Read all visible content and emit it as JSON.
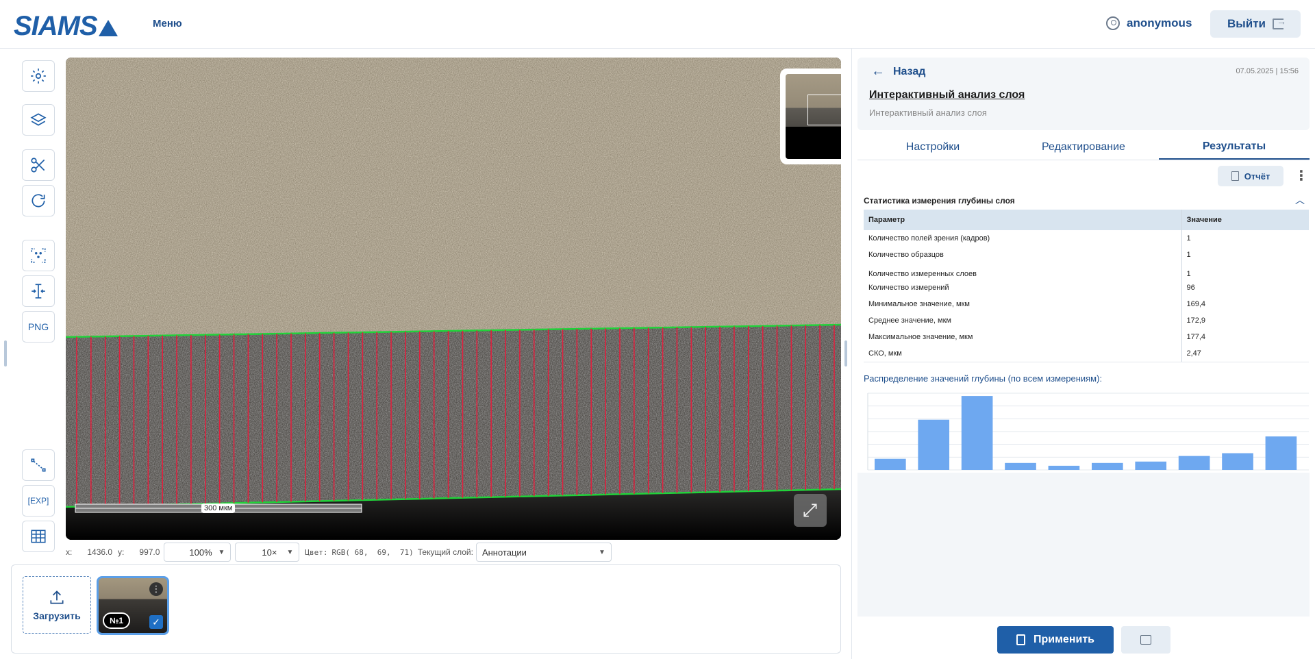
{
  "header": {
    "logo": "SIAMS",
    "menu_label": "Меню",
    "username": "anonymous",
    "logout_label": "Выйти"
  },
  "toolbar": {
    "tools": [
      {
        "name": "settings-icon"
      },
      {
        "name": "layers-icon"
      },
      {
        "name": "scissors-icon"
      },
      {
        "name": "refresh-icon"
      },
      {
        "name": "focus-points-icon"
      },
      {
        "name": "measure-icon"
      },
      {
        "name": "png-export",
        "label": "PNG"
      },
      {
        "name": "line-tool-icon"
      },
      {
        "name": "exp-export",
        "label": "EXP"
      },
      {
        "name": "table-icon"
      }
    ]
  },
  "viewer": {
    "scale_bar_label": "300 мкм",
    "measurement_count": 54
  },
  "status": {
    "x_label": "x:",
    "x_value": "1436.0",
    "y_label": "y:",
    "y_value": "997.0",
    "zoom": "100%",
    "magnification": "10×",
    "color_label": "Цвет:",
    "color_value": "RGB( 68,  69,  71)",
    "layer_label": "Текущий слой:",
    "layer_value": "Аннотации"
  },
  "gallery": {
    "upload_label": "Загрузить",
    "items": [
      {
        "badge": "№1",
        "selected": true
      }
    ]
  },
  "panel": {
    "back_label": "Назад",
    "date": "07.05.2025 | 15:56",
    "title": "Интерактивный анализ слоя",
    "subtitle": "Интерактивный анализ слоя",
    "tabs": [
      {
        "label": "Настройки",
        "active": false
      },
      {
        "label": "Редактирование",
        "active": false
      },
      {
        "label": "Результаты",
        "active": true
      }
    ],
    "report_label": "Отчёт",
    "section_title": "Статистика измерения глубины слоя",
    "table": {
      "headers": [
        "Параметр",
        "Значение"
      ],
      "rows": [
        [
          "Количество полей зрения (кадров)",
          "1"
        ],
        [
          "Количество образцов",
          "1"
        ],
        [
          "Количество измеренных слоев",
          "1"
        ],
        [
          "Количество измерений",
          "96"
        ],
        [
          "Минимальное значение, мкм",
          "169,4"
        ],
        [
          "Среднее значение, мкм",
          "172,9"
        ],
        [
          "Максимальное значение, мкм",
          "177,4"
        ],
        [
          "СКО, мкм",
          "2,47"
        ]
      ]
    },
    "distribution_title": "Распределение значений глубины (по всем измерениям):",
    "apply_label": "Применить"
  },
  "chart_data": {
    "type": "bar",
    "values": [
      8,
      36,
      53,
      5,
      3,
      5,
      6,
      10,
      12,
      24
    ],
    "ylim": [
      0,
      55
    ],
    "grid": true,
    "bar_color": "#6ea8f0"
  },
  "colors": {
    "accent": "#1f5fa8",
    "boundary_line": "#21d23a",
    "measurement_line": "#e0203e"
  }
}
